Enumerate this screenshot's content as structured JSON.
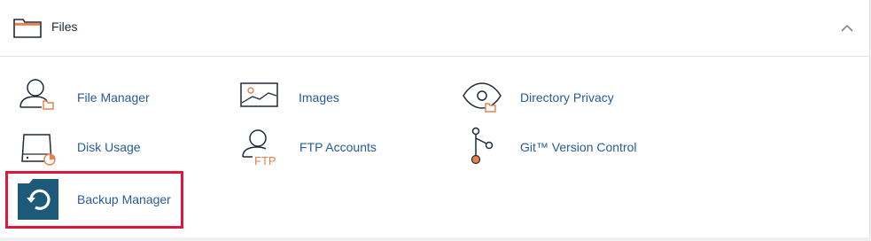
{
  "section": {
    "title": "Files",
    "icon": "folder-icon",
    "collapse_icon": "chevron-up-icon"
  },
  "items": [
    {
      "label": "File Manager",
      "icon": "file-manager-icon"
    },
    {
      "label": "Images",
      "icon": "images-icon"
    },
    {
      "label": "Directory Privacy",
      "icon": "directory-privacy-icon"
    },
    {
      "label": "Disk Usage",
      "icon": "disk-usage-icon"
    },
    {
      "label": "FTP Accounts",
      "icon": "ftp-accounts-icon",
      "icon_text": "FTP"
    },
    {
      "label": "Git™ Version Control",
      "icon": "git-version-control-icon"
    },
    {
      "label": "Backup Manager",
      "icon": "backup-manager-icon",
      "highlighted": true
    }
  ],
  "colors": {
    "link": "#295a9a",
    "accent": "#e8804a",
    "highlight": "#e0173c",
    "icon_dark": "#1f2a38",
    "backup_bg": "#1d5a7a"
  }
}
